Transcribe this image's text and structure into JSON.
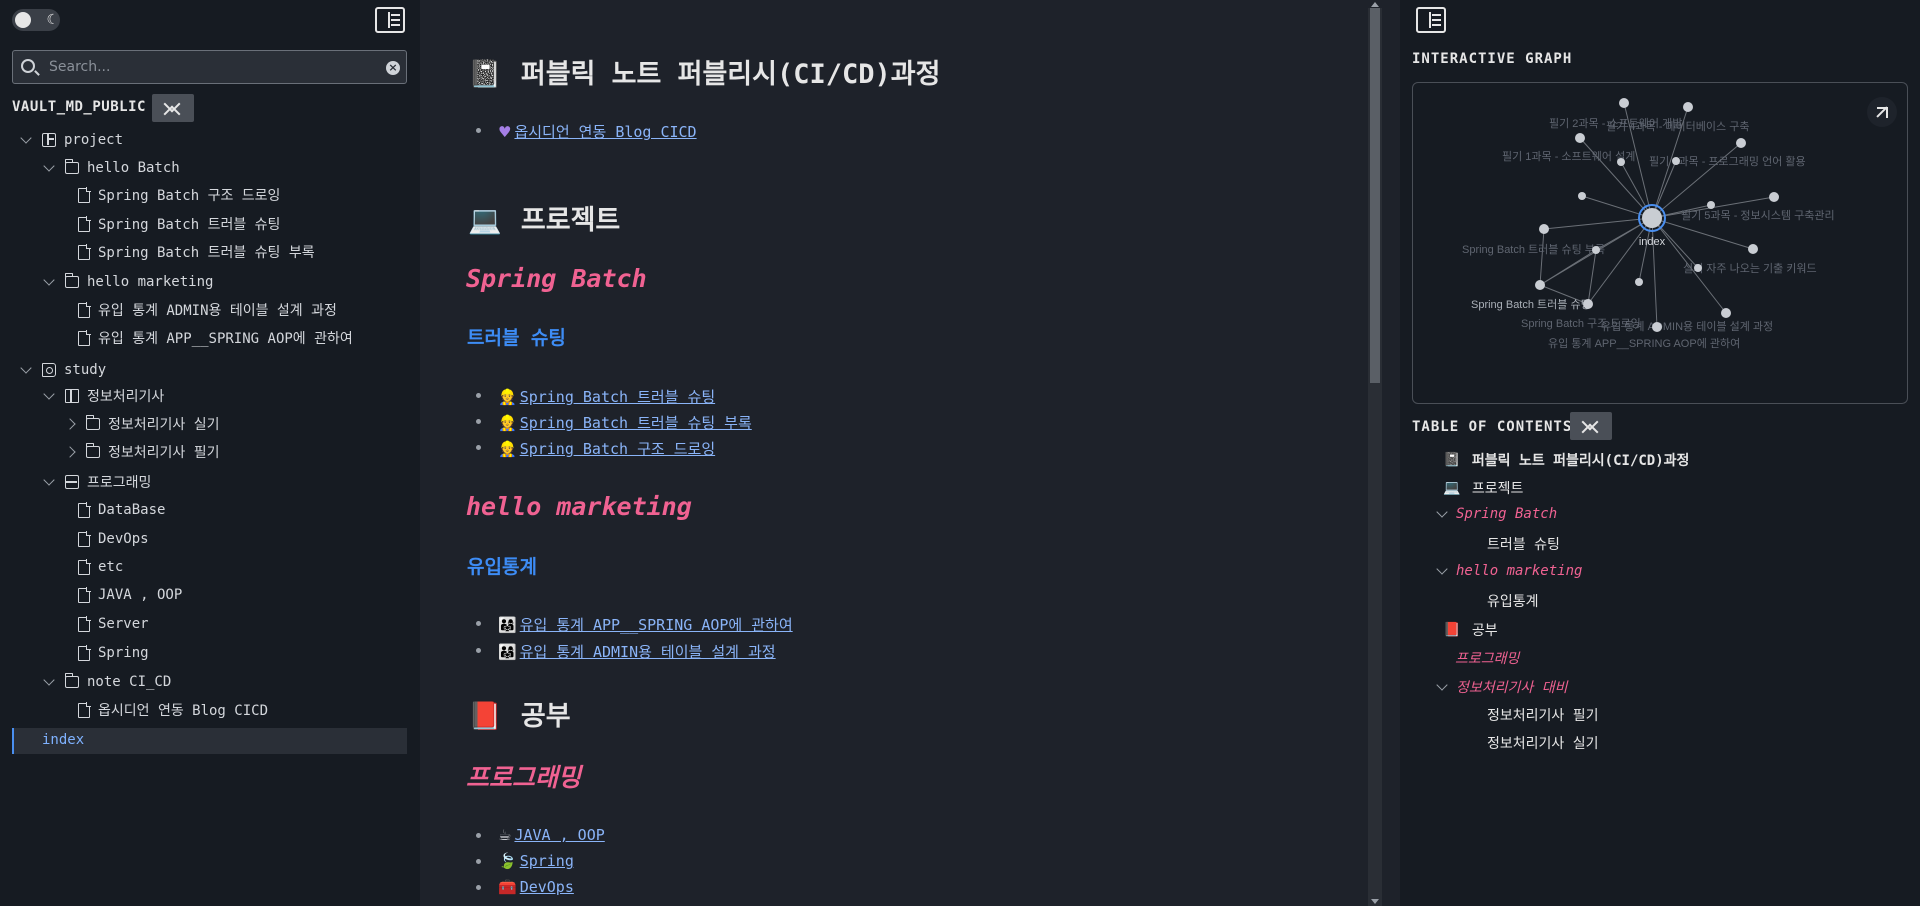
{
  "left": {
    "search_placeholder": "Search...",
    "vault_name": "VAULT_MD_PUBLIC",
    "tree": {
      "project": "project",
      "hello_batch": "hello Batch",
      "hb1": "Spring Batch 구조 드로잉",
      "hb2": "Spring Batch 트러블 슈팅",
      "hb3": "Spring Batch 트러블 슈팅 부록",
      "hello_marketing": "hello marketing",
      "hm1": "유입 통계 ADMIN용 테이블 설계 과정",
      "hm2": "유입 통계 APP__SPRING AOP에 관하여",
      "study": "study",
      "jeongbo": "정보처리기사",
      "silgi": "정보처리기사 실기",
      "pilgi": "정보처리기사 필기",
      "programming": "프로그래밍",
      "p1": "DataBase",
      "p2": "DevOps",
      "p3": "etc",
      "p4": "JAVA , OOP",
      "p5": "Server",
      "p6": "Spring",
      "note": "note CI_CD",
      "n1": "옵시디언 연동 Blog CICD",
      "index": "index"
    }
  },
  "main": {
    "h1_note": "퍼블릭 노트 퍼블리시(CI/CD)과정",
    "note_link": "옵시디언 연동 Blog CICD",
    "h1_project": "프로젝트",
    "h3_spring": "Spring Batch",
    "h4_trouble": "트러블 슈팅",
    "sb_links": [
      "Spring Batch 트러블 슈팅",
      "Spring Batch 트러블 슈팅 부록",
      "Spring Batch 구조 드로잉"
    ],
    "h3_marketing": "hello marketing",
    "h4_inflow": "유입통계",
    "mk_links": [
      "유입 통계 APP__SPRING AOP에 관하여",
      "유입 통계 ADMIN용 테이블 설계 과정"
    ],
    "h1_study": "공부",
    "h3_prog": "프로그래밍",
    "prog_links": [
      "JAVA , OOP",
      "Spring",
      "DevOps"
    ]
  },
  "right": {
    "graph_title": "INTERACTIVE GRAPH",
    "graph_center_label": "index",
    "graph_labels": [
      "필기 2과목 - 소프트웨어 개발",
      "필기 4과목 - 데이터베이스 구축",
      "필기 1과목 - 소프트웨어 설계",
      "필기 3과목 - 프로그래밍 언어 활용",
      "필기 5과목 - 정보시스템 구축관리",
      "Spring Batch 트러블 슈팅 부록",
      "실기 자주 나오는 기출 키워드",
      "Spring Batch 트러블 슈팅",
      "Spring Batch 구조 드로잉",
      "유입 통계 ADMIN용 테이블 설계 과정",
      "유입 통계 APP__SPRING AOP에 관하여"
    ],
    "toc_title": "TABLE OF CONTENTS",
    "toc": {
      "t1": "퍼블릭 노트 퍼블리시(CI/CD)과정",
      "t2": "프로젝트",
      "t3": "Spring Batch",
      "t4": "트러블 슈팅",
      "t5": "hello marketing",
      "t6": "유입통계",
      "t7": "공부",
      "t8": "프로그래밍",
      "t9": "정보처리기사 대비",
      "t10": "정보처리기사 필기",
      "t11": "정보처리기사 실기"
    }
  },
  "colors": {
    "accent_pink": "#f06292",
    "accent_blue": "#3d8cf5",
    "link": "#8ab4f8",
    "sidebar_bg": "#161b22",
    "content_bg": "#1e222a"
  }
}
